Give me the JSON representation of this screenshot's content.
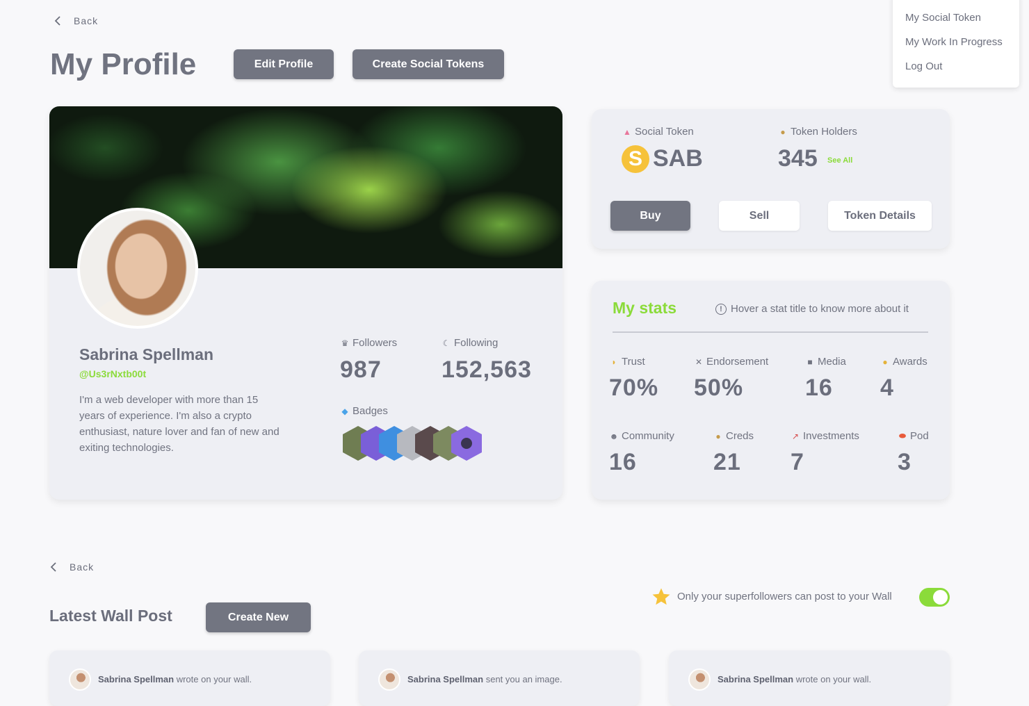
{
  "nav": {
    "back_label": "Back"
  },
  "page": {
    "title": "My Profile",
    "edit_button": "Edit Profile",
    "create_tokens_button": "Create Social Tokens"
  },
  "dropdown": {
    "items": [
      "My Social Token",
      "My Work In Progress",
      "Log Out"
    ]
  },
  "profile": {
    "name": "Sabrina Spellman",
    "handle": "@Us3rNxtb00t",
    "bio": "I'm a web developer with more than 15 years of experience. I'm also a crypto enthusiast, nature lover and fan of new and exiting  technologies.",
    "followers_label": "Followers",
    "followers_value": "987",
    "following_label": "Following",
    "following_value": "152,563",
    "badges_label": "Badges",
    "badge_count": 7
  },
  "token": {
    "social_token_label": "Social Token",
    "symbol": "SAB",
    "holders_label": "Token Holders",
    "holders_value": "345",
    "see_all": "See All",
    "buy": "Buy",
    "sell": "Sell",
    "details": "Token Details"
  },
  "stats": {
    "title": "My stats",
    "hint": "Hover a stat title to know more about it",
    "items": [
      {
        "label": "Trust",
        "value": "70%"
      },
      {
        "label": "Endorsement",
        "value": "50%"
      },
      {
        "label": "Media",
        "value": "16"
      },
      {
        "label": "Awards",
        "value": "4"
      },
      {
        "label": "Community",
        "value": "16"
      },
      {
        "label": "Creds",
        "value": "21"
      },
      {
        "label": "Investments",
        "value": "7"
      },
      {
        "label": "Pod",
        "value": "3"
      }
    ]
  },
  "wall": {
    "back_label": "Back",
    "title": "Latest Wall Post",
    "create_button": "Create New",
    "superfollowers_text": "Only your superfollowers can post to your Wall",
    "superfollowers_only": true,
    "posts": [
      {
        "author": "Sabrina Spellman",
        "action": "wrote on your wall."
      },
      {
        "author": "Sabrina Spellman",
        "action": "sent you an image."
      },
      {
        "author": "Sabrina Spellman",
        "action": "wrote on your wall."
      }
    ]
  },
  "colors": {
    "accent_green": "#8bdb3a",
    "token_yellow": "#f6c23a",
    "button_dark": "#727581"
  }
}
